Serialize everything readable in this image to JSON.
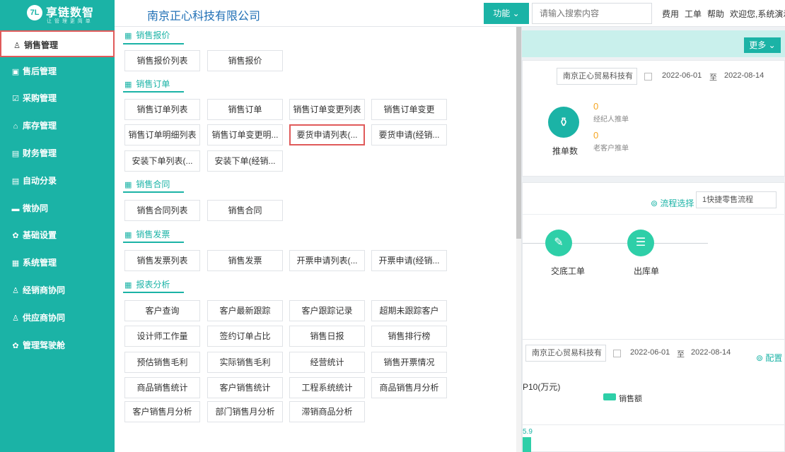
{
  "header": {
    "logo_mark": "7L",
    "logo_text": "享链数智",
    "logo_sub": "让 管 理 更 简 单",
    "company": "南京正心科技有限公司",
    "func_label": "功能 ⌄",
    "search_placeholder": "请输入搜索内容",
    "links": [
      "费用",
      "工单",
      "帮助",
      "欢迎您,系统演示"
    ]
  },
  "sidebar": {
    "items": [
      {
        "icon": "♙",
        "label": "销售管理"
      },
      {
        "icon": "▣",
        "label": "售后管理"
      },
      {
        "icon": "☑",
        "label": "采购管理"
      },
      {
        "icon": "⌂",
        "label": "库存管理"
      },
      {
        "icon": "▤",
        "label": "财务管理"
      },
      {
        "icon": "▤",
        "label": "自动分录"
      },
      {
        "icon": "▬",
        "label": "微协同"
      },
      {
        "icon": "✿",
        "label": "基础设置"
      },
      {
        "icon": "▦",
        "label": "系统管理"
      },
      {
        "icon": "♙",
        "label": "经销商协同"
      },
      {
        "icon": "♙",
        "label": "供应商协同"
      },
      {
        "icon": "✿",
        "label": "管理驾驶舱"
      }
    ]
  },
  "menu": {
    "sections": [
      {
        "title": "销售报价",
        "items": [
          "销售报价列表",
          "销售报价"
        ]
      },
      {
        "title": "销售订单",
        "items": [
          "销售订单列表",
          "销售订单",
          "销售订单变更列表",
          "销售订单变更",
          "销售订单明细列表",
          "销售订单变更明...",
          "要货申请列表(...",
          "要货申请(经销...",
          "安装下单列表(...",
          "安装下单(经销..."
        ]
      },
      {
        "title": "销售合同",
        "items": [
          "销售合同列表",
          "销售合同"
        ]
      },
      {
        "title": "销售发票",
        "items": [
          "销售发票列表",
          "销售发票",
          "开票申请列表(...",
          "开票申请(经销..."
        ]
      },
      {
        "title": "报表分析",
        "items": [
          "客户查询",
          "客户最新跟踪",
          "客户跟踪记录",
          "超期未跟踪客户",
          "设计师工作量",
          "签约订单占比",
          "销售日报",
          "销售排行榜",
          "预估销售毛利",
          "实际销售毛利",
          "经营统计",
          "销售开票情况",
          "商品销售统计",
          "客户销售统计",
          "工程系统统计",
          "商品销售月分析",
          "客户销售月分析",
          "部门销售月分析",
          "滞销商品分析"
        ]
      }
    ]
  },
  "dash": {
    "more_label": "更多 ⌄",
    "card1": {
      "company_select": "南京正心贸易科技有",
      "date_from": "2022-06-01",
      "date_sep": "至",
      "date_to": "2022-08-14",
      "num1": "0",
      "label1": "经纪人推单",
      "num2": "0",
      "label2": "老客户推单",
      "title": "推单数"
    },
    "card2": {
      "flow_link": "⊚ 流程选择",
      "flow_select": "1快捷零售流程",
      "steps": [
        "交底工单",
        "出库单"
      ]
    },
    "card3": {
      "company_select": "南京正心贸易科技有",
      "date_from": "2022-06-01",
      "date_sep": "至",
      "date_to": "2022-08-14",
      "config": "⊚ 配置",
      "chart_title": "P10(万元)",
      "legend": "销售额",
      "value_label": "5.9"
    }
  }
}
